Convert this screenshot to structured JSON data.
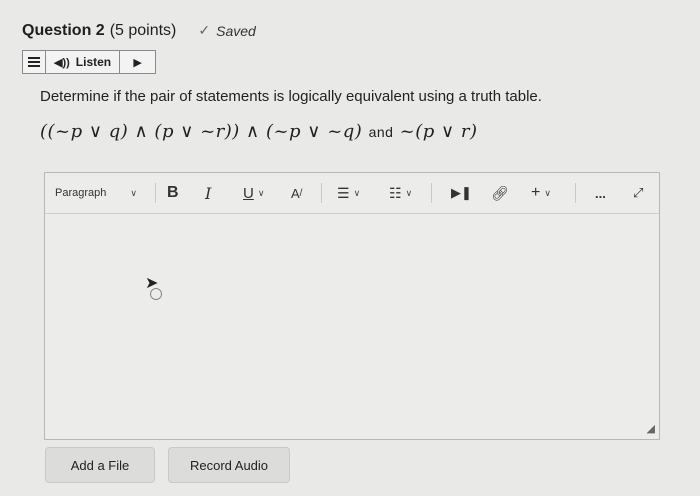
{
  "question": {
    "title": "Question 2",
    "points": "(5 points)",
    "status": "Saved"
  },
  "listen_bar": {
    "menu_icon": "hamburger-menu-icon",
    "listen_label": "Listen",
    "play_icon": "play-icon"
  },
  "prompt": "Determine if the pair of statements is logically equivalent using a truth table.",
  "formula": {
    "left": "((~p ∨ q) ∧ (p ∨ ~r)) ∧ (~p ∨ ~q)",
    "connector": "and",
    "right": "~(p ∨ r)"
  },
  "toolbar": {
    "paragraph": "Paragraph",
    "bold": "B",
    "italic": "I",
    "underline": "U",
    "font_color": "A",
    "more": "...",
    "insert_plus": "+"
  },
  "buttons": {
    "add_file": "Add a File",
    "record_audio": "Record Audio"
  }
}
